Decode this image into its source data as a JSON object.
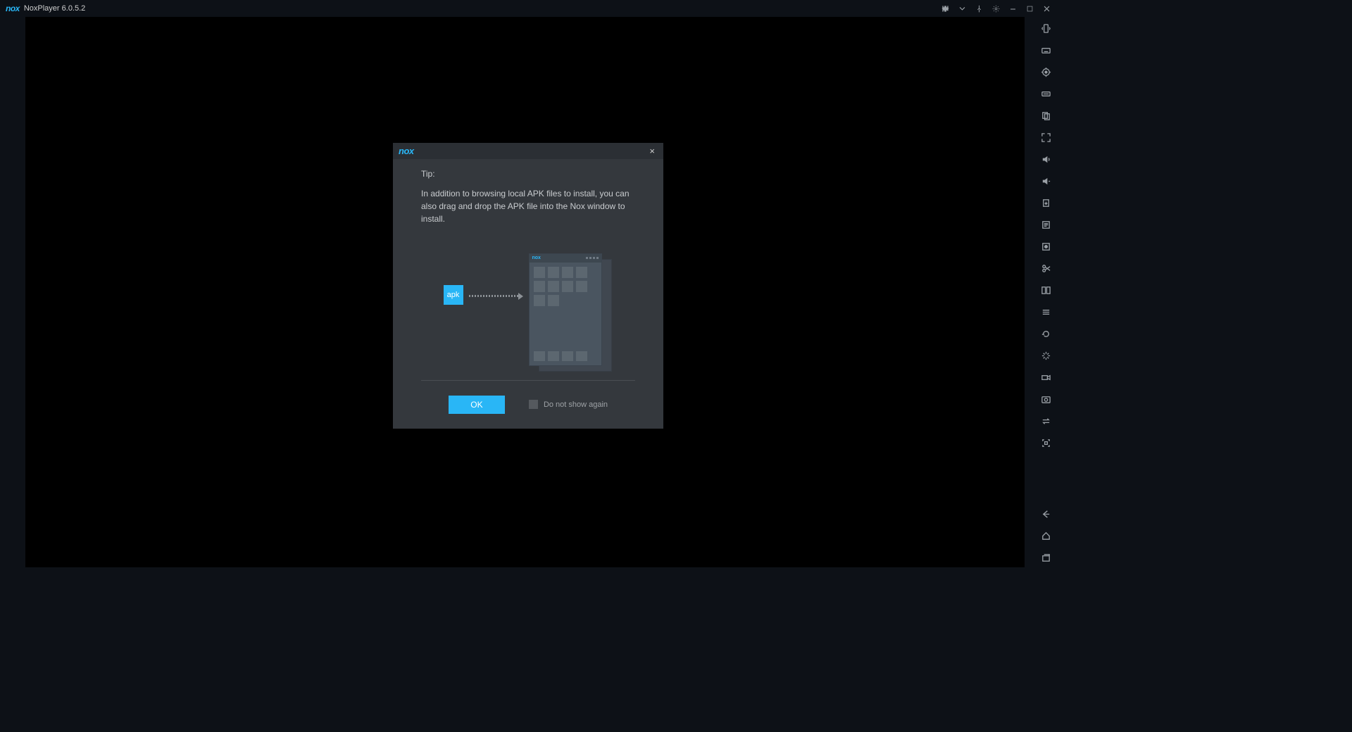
{
  "titlebar": {
    "logo": "nox",
    "title": "NoxPlayer 6.0.5.2"
  },
  "dialog": {
    "logo": "nox",
    "tip_label": "Tip:",
    "tip_text": "In addition to browsing local APK files to install, you can also drag and drop the APK file into the Nox window to install.",
    "apk_badge": "apk",
    "mini_logo": "nox",
    "ok_label": "OK",
    "dont_show_label": "Do not show again",
    "close_glyph": "×"
  }
}
